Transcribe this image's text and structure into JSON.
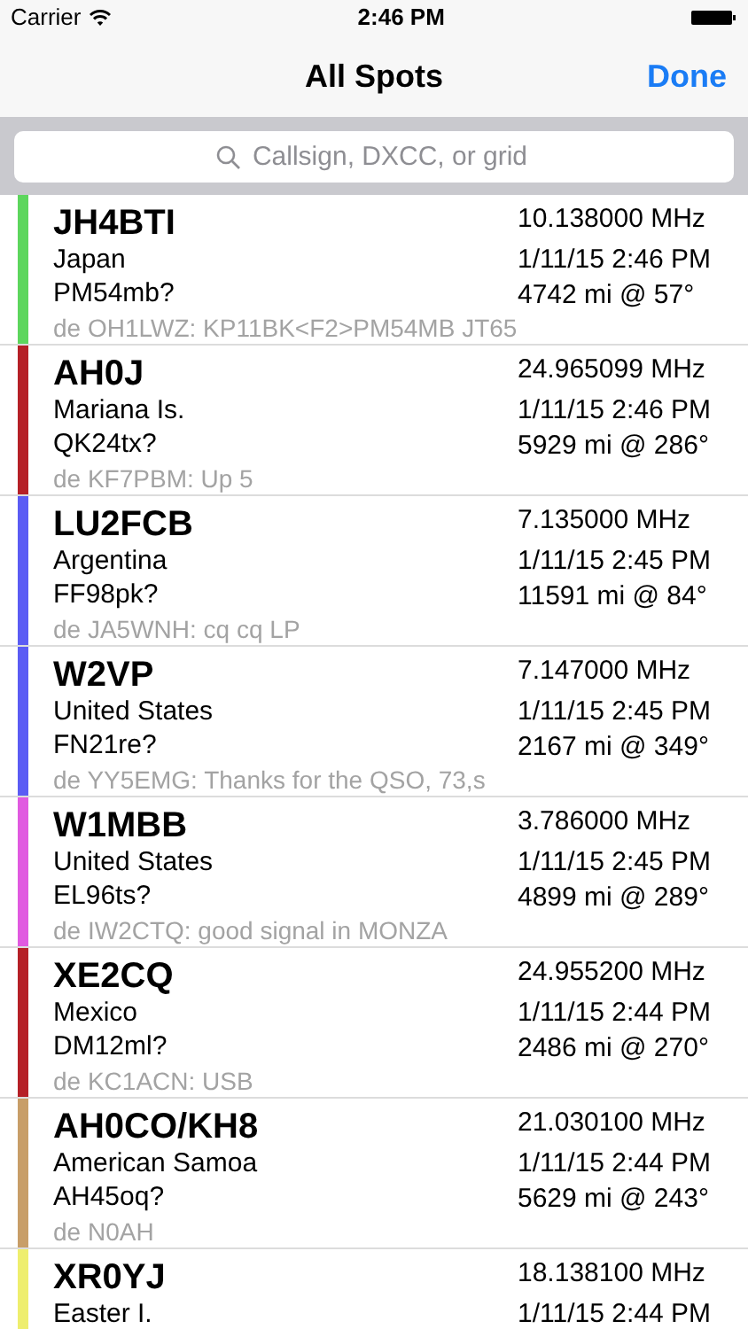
{
  "status_bar": {
    "carrier": "Carrier",
    "time": "2:46 PM"
  },
  "nav": {
    "title": "All Spots",
    "done": "Done"
  },
  "search": {
    "placeholder": "Callsign, DXCC, or grid"
  },
  "spots": [
    {
      "callsign": "JH4BTI",
      "country": "Japan",
      "grid": "PM54mb?",
      "comment": "de OH1LWZ: KP11BK<F2>PM54MB JT65",
      "frequency": "10.138000 MHz",
      "time": "1/11/15 2:46 PM",
      "distance": "4742 mi @ 57°",
      "color": "#5dd65d"
    },
    {
      "callsign": "AH0J",
      "country": "Mariana Is.",
      "grid": "QK24tx?",
      "comment": "de KF7PBM: Up 5",
      "frequency": "24.965099 MHz",
      "time": "1/11/15 2:46 PM",
      "distance": "5929 mi @ 286°",
      "color": "#b52027"
    },
    {
      "callsign": "LU2FCB",
      "country": "Argentina",
      "grid": "FF98pk?",
      "comment": "de JA5WNH: cq cq LP",
      "frequency": "7.135000 MHz",
      "time": "1/11/15 2:45 PM",
      "distance": "11591 mi @ 84°",
      "color": "#5b5cf4"
    },
    {
      "callsign": "W2VP",
      "country": "United States",
      "grid": "FN21re?",
      "comment": "de YY5EMG: Thanks for the QSO, 73,s",
      "frequency": "7.147000 MHz",
      "time": "1/11/15 2:45 PM",
      "distance": "2167 mi @ 349°",
      "color": "#5b5cf4"
    },
    {
      "callsign": "W1MBB",
      "country": "United States",
      "grid": "EL96ts?",
      "comment": "de IW2CTQ: good signal in MONZA",
      "frequency": "3.786000 MHz",
      "time": "1/11/15 2:45 PM",
      "distance": "4899 mi @ 289°",
      "color": "#e05ae0"
    },
    {
      "callsign": "XE2CQ",
      "country": "Mexico",
      "grid": "DM12ml?",
      "comment": "de KC1ACN: USB",
      "frequency": "24.955200 MHz",
      "time": "1/11/15 2:44 PM",
      "distance": "2486 mi @ 270°",
      "color": "#b52027"
    },
    {
      "callsign": "AH0CO/KH8",
      "country": "American Samoa",
      "grid": "AH45oq?",
      "comment": "de N0AH",
      "frequency": "21.030100 MHz",
      "time": "1/11/15 2:44 PM",
      "distance": "5629 mi @ 243°",
      "color": "#c89e68"
    },
    {
      "callsign": "XR0YJ",
      "country": "Easter I.",
      "frequency": "18.138100 MHz",
      "time": "1/11/15 2:44 PM",
      "color": "#eeee6e"
    }
  ]
}
